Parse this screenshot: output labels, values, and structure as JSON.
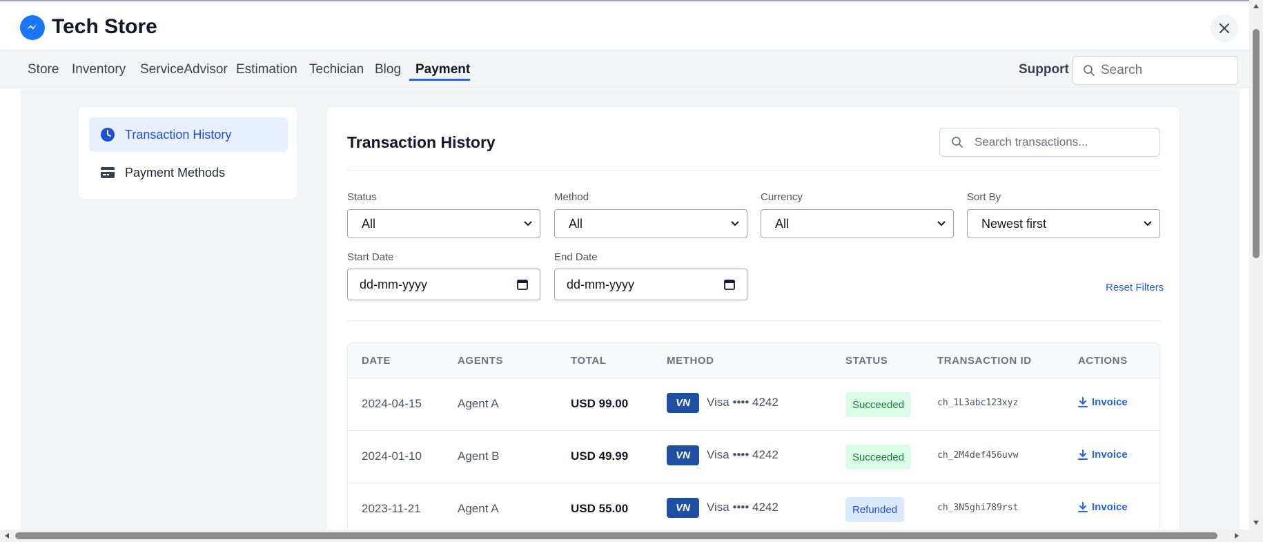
{
  "app": {
    "title": "Tech Store",
    "logo_icon": "messenger-icon",
    "brand_color": "#1877f2"
  },
  "nav": {
    "items": [
      "Store",
      "Inventory",
      "ServiceAdvisor",
      "Estimation",
      "Techician",
      "Blog",
      "Payment"
    ],
    "active": "Payment",
    "support_label": "Support",
    "search_placeholder": "Search"
  },
  "sidebar": {
    "items": [
      {
        "label": "Transaction History",
        "icon": "clock-icon",
        "active": true
      },
      {
        "label": "Payment Methods",
        "icon": "credit-card-icon",
        "active": false
      }
    ]
  },
  "main": {
    "title": "Transaction History",
    "search_placeholder": "Search transactions...",
    "filters": {
      "status": {
        "label": "Status",
        "value": "All"
      },
      "method": {
        "label": "Method",
        "value": "All"
      },
      "currency": {
        "label": "Currency",
        "value": "All"
      },
      "sort": {
        "label": "Sort By",
        "value": "Newest first"
      },
      "start_date": {
        "label": "Start Date",
        "value": "dd-mm-yyyy"
      },
      "end_date": {
        "label": "End Date",
        "value": "dd-mm-yyyy"
      },
      "reset_label": "Reset Filters"
    },
    "table": {
      "headers": [
        "DATE",
        "AGENTS",
        "TOTAL",
        "METHOD",
        "STATUS",
        "TRANSACTION ID",
        "ACTIONS"
      ],
      "rows": [
        {
          "date": "2024-04-15",
          "agent": "Agent A",
          "total": "USD 99.00",
          "card_brand": "VN",
          "method": "Visa •••• 4242",
          "status": "Succeeded",
          "txid": "ch_1L3abc123xyz",
          "action": "Invoice"
        },
        {
          "date": "2024-01-10",
          "agent": "Agent B",
          "total": "USD 49.99",
          "card_brand": "VN",
          "method": "Visa •••• 4242",
          "status": "Succeeded",
          "txid": "ch_2M4def456uvw",
          "action": "Invoice"
        },
        {
          "date": "2023-11-21",
          "agent": "Agent A",
          "total": "USD 55.00",
          "card_brand": "VN",
          "method": "Visa •••• 4242",
          "status": "Refunded",
          "txid": "ch_3N5ghi789rst",
          "action": "Invoice"
        }
      ]
    }
  },
  "colors": {
    "accent": "#2563eb",
    "succeeded_bg": "#dcfce7",
    "succeeded_text": "#15803d",
    "refunded_bg": "#dbeafe",
    "refunded_text": "#1d4ed8",
    "card_brand_bg": "#1e4fa3"
  }
}
